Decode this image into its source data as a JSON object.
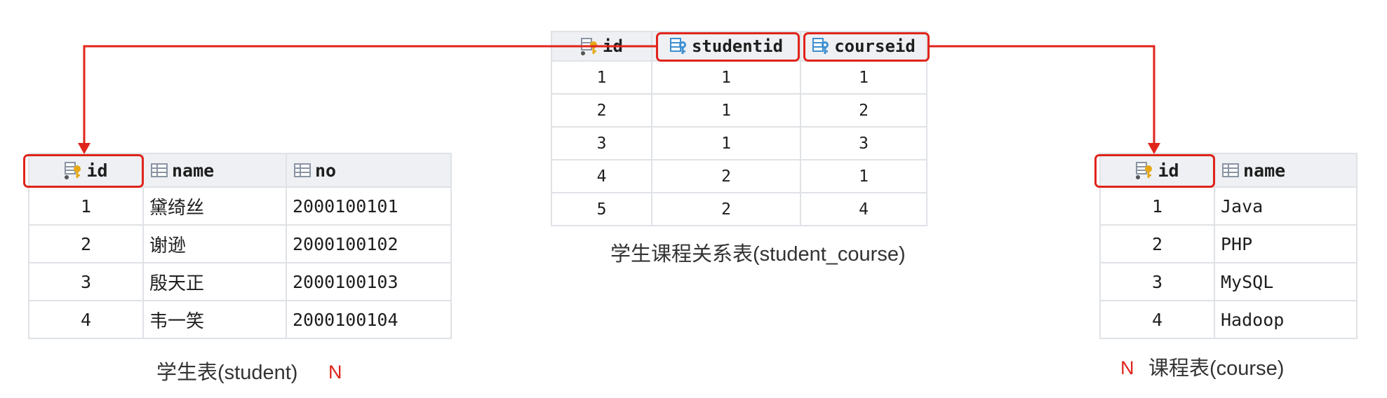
{
  "student_table": {
    "columns": [
      {
        "label": "id",
        "icon": "primary-key-column-icon"
      },
      {
        "label": "name",
        "icon": "column-icon"
      },
      {
        "label": "no",
        "icon": "column-icon"
      }
    ],
    "rows": [
      [
        "1",
        "黛绮丝",
        "2000100101"
      ],
      [
        "2",
        "谢逊",
        "2000100102"
      ],
      [
        "3",
        "殷天正",
        "2000100103"
      ],
      [
        "4",
        "韦一笑",
        "2000100104"
      ]
    ],
    "caption": "学生表(student)",
    "multiplicity": "N"
  },
  "link_table": {
    "columns": [
      {
        "label": "id",
        "icon": "primary-key-column-icon"
      },
      {
        "label": "studentid",
        "icon": "foreign-key-column-icon"
      },
      {
        "label": "courseid",
        "icon": "foreign-key-column-icon"
      }
    ],
    "rows": [
      [
        "1",
        "1",
        "1"
      ],
      [
        "2",
        "1",
        "2"
      ],
      [
        "3",
        "1",
        "3"
      ],
      [
        "4",
        "2",
        "1"
      ],
      [
        "5",
        "2",
        "4"
      ]
    ],
    "caption": "学生课程关系表(student_course)"
  },
  "course_table": {
    "columns": [
      {
        "label": "id",
        "icon": "primary-key-column-icon"
      },
      {
        "label": "name",
        "icon": "column-icon"
      }
    ],
    "rows": [
      [
        "1",
        "Java"
      ],
      [
        "2",
        "PHP"
      ],
      [
        "3",
        "MySQL"
      ],
      [
        "4",
        "Hadoop"
      ]
    ],
    "caption": "课程表(course)",
    "multiplicity": "N"
  },
  "colors": {
    "highlight": "#e0241b",
    "header_bg": "#eef0f3",
    "grid": "#dfe2e6",
    "key_icon": "#e6a817",
    "fk_icon": "#3d8fd1",
    "column_icon": "#8a94a3"
  }
}
